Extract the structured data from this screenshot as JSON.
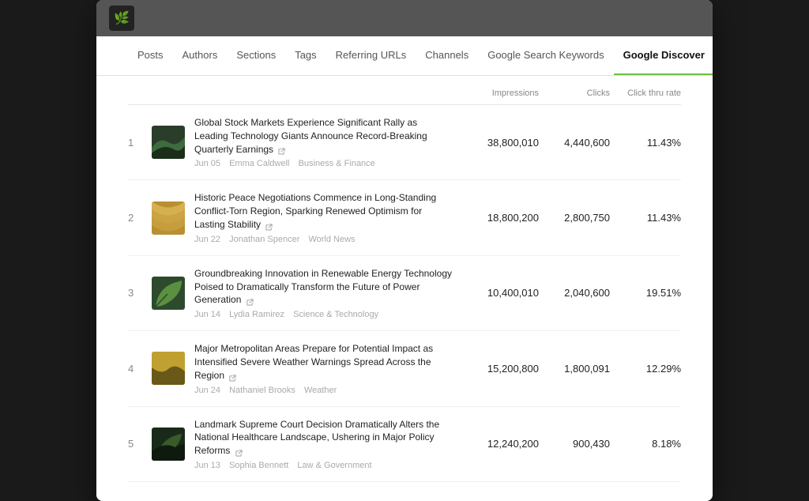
{
  "app": {
    "logo_symbol": "🌿"
  },
  "nav": {
    "items": [
      {
        "label": "Posts",
        "active": false
      },
      {
        "label": "Authors",
        "active": false
      },
      {
        "label": "Sections",
        "active": false
      },
      {
        "label": "Tags",
        "active": false
      },
      {
        "label": "Referring URLs",
        "active": false
      },
      {
        "label": "Channels",
        "active": false
      },
      {
        "label": "Google Search Keywords",
        "active": false
      },
      {
        "label": "Google Discover",
        "active": true
      }
    ]
  },
  "table": {
    "columns": {
      "impressions": "Impressions",
      "clicks": "Clicks",
      "ctr": "Click thru rate"
    },
    "rows": [
      {
        "rank": "1",
        "title": "Global Stock Markets Experience Significant Rally as Leading Technology Giants Announce Record-Breaking Quarterly Earnings",
        "date": "Jun 05",
        "author": "Emma Caldwell",
        "section": "Business & Finance",
        "impressions": "38,800,010",
        "clicks": "4,440,600",
        "ctr": "11.43%",
        "thumb_color1": "#2d4a2d",
        "thumb_color2": "#3d6b3d"
      },
      {
        "rank": "2",
        "title": "Historic Peace Negotiations Commence in Long-Standing Conflict-Torn Region, Sparking Renewed Optimism for Lasting Stability",
        "date": "Jun 22",
        "author": "Jonathan Spencer",
        "section": "World News",
        "impressions": "18,800,200",
        "clicks": "2,800,750",
        "ctr": "11.43%",
        "thumb_color1": "#c8a84b",
        "thumb_color2": "#d4b86a"
      },
      {
        "rank": "3",
        "title": "Groundbreaking Innovation in Renewable Energy Technology Poised to Dramatically Transform the Future of Power Generation",
        "date": "Jun 14",
        "author": "Lydia Ramirez",
        "section": "Science & Technology",
        "impressions": "10,400,010",
        "clicks": "2,040,600",
        "ctr": "19.51%",
        "thumb_color1": "#4a7c3f",
        "thumb_color2": "#2d5a2d"
      },
      {
        "rank": "4",
        "title": "Major Metropolitan Areas Prepare for Potential Impact as Intensified Severe Weather Warnings Spread Across the Region",
        "date": "Jun 24",
        "author": "Nathaniel Brooks",
        "section": "Weather",
        "impressions": "15,200,800",
        "clicks": "1,800,091",
        "ctr": "12.29%",
        "thumb_color1": "#b8a040",
        "thumb_color2": "#8a7a2d"
      },
      {
        "rank": "5",
        "title": "Landmark Supreme Court Decision Dramatically Alters the National Healthcare Landscape, Ushering in Major Policy Reforms",
        "date": "Jun 13",
        "author": "Sophia Bennett",
        "section": "Law & Government",
        "impressions": "12,240,200",
        "clicks": "900,430",
        "ctr": "8.18%",
        "thumb_color1": "#3a5a2a",
        "thumb_color2": "#1a2a1a"
      }
    ]
  }
}
